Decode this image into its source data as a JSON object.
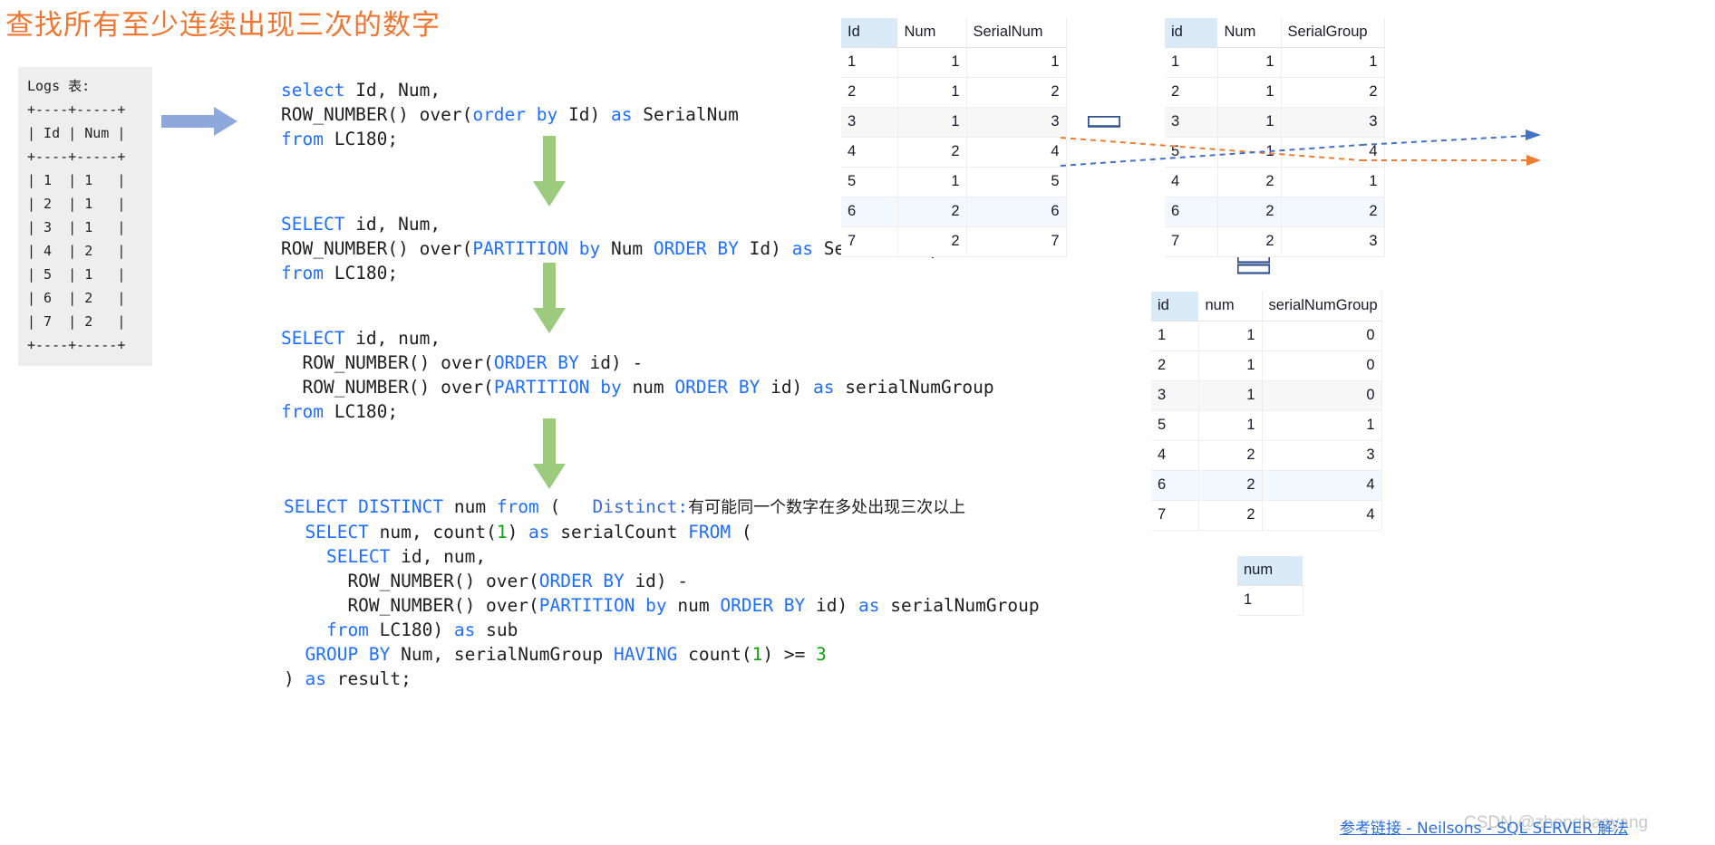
{
  "title": "查找所有至少连续出现三次的数字",
  "logs_table": {
    "caption": "Logs 表:",
    "ascii": "Logs 表:\n+----+-----+\n| Id | Num |\n+----+-----+\n| 1  | 1   |\n| 2  | 1   |\n| 3  | 1   |\n| 4  | 2   |\n| 5  | 1   |\n| 6  | 2   |\n| 7  | 2   |\n+----+-----+"
  },
  "sql_blocks": {
    "block1": {
      "lines": [
        [
          {
            "t": "select ",
            "c": "kw"
          },
          {
            "t": "Id, Num,",
            "c": ""
          }
        ],
        [
          {
            "t": "ROW_NUMBER() over(",
            "c": ""
          },
          {
            "t": "order by ",
            "c": "kw"
          },
          {
            "t": "Id) ",
            "c": ""
          },
          {
            "t": "as ",
            "c": "kw"
          },
          {
            "t": "SerialNum",
            "c": ""
          }
        ],
        [
          {
            "t": "from ",
            "c": "kw"
          },
          {
            "t": "LC180;",
            "c": ""
          }
        ]
      ]
    },
    "block2": {
      "lines": [
        [
          {
            "t": "SELECT ",
            "c": "kw"
          },
          {
            "t": "id, Num,",
            "c": ""
          }
        ],
        [
          {
            "t": "ROW_NUMBER() over(",
            "c": ""
          },
          {
            "t": "PARTITION by ",
            "c": "kw"
          },
          {
            "t": "Num ",
            "c": ""
          },
          {
            "t": "ORDER BY ",
            "c": "kw"
          },
          {
            "t": "Id) ",
            "c": ""
          },
          {
            "t": "as ",
            "c": "kw"
          },
          {
            "t": "SerialGroup",
            "c": ""
          }
        ],
        [
          {
            "t": "from ",
            "c": "kw"
          },
          {
            "t": "LC180;",
            "c": ""
          }
        ]
      ]
    },
    "block3": {
      "lines": [
        [
          {
            "t": "SELECT ",
            "c": "kw"
          },
          {
            "t": "id, num,",
            "c": ""
          }
        ],
        [
          {
            "t": "  ROW_NUMBER() over(",
            "c": ""
          },
          {
            "t": "ORDER BY ",
            "c": "kw"
          },
          {
            "t": "id) -",
            "c": ""
          }
        ],
        [
          {
            "t": "  ROW_NUMBER() over(",
            "c": ""
          },
          {
            "t": "PARTITION by ",
            "c": "kw"
          },
          {
            "t": "num ",
            "c": ""
          },
          {
            "t": "ORDER BY ",
            "c": "kw"
          },
          {
            "t": "id) ",
            "c": ""
          },
          {
            "t": "as ",
            "c": "kw"
          },
          {
            "t": "serialNumGroup",
            "c": ""
          }
        ],
        [
          {
            "t": "from ",
            "c": "kw"
          },
          {
            "t": "LC180;",
            "c": ""
          }
        ]
      ]
    },
    "block4": {
      "lines": [
        [
          {
            "t": "SELECT DISTINCT ",
            "c": "kw"
          },
          {
            "t": "num ",
            "c": ""
          },
          {
            "t": "from ",
            "c": "kw"
          },
          {
            "t": "(   ",
            "c": ""
          },
          {
            "t": "Distinct:",
            "c": "cmt"
          },
          {
            "t": "有可能同一个数字在多处出现三次以上",
            "c": "cmt-cn"
          }
        ],
        [
          {
            "t": "  SELECT ",
            "c": "kw"
          },
          {
            "t": "num, count(",
            "c": ""
          },
          {
            "t": "1",
            "c": "num"
          },
          {
            "t": ") ",
            "c": ""
          },
          {
            "t": "as ",
            "c": "kw"
          },
          {
            "t": "serialCount ",
            "c": ""
          },
          {
            "t": "FROM ",
            "c": "kw"
          },
          {
            "t": "(",
            "c": ""
          }
        ],
        [
          {
            "t": "    SELECT ",
            "c": "kw"
          },
          {
            "t": "id, num,",
            "c": ""
          }
        ],
        [
          {
            "t": "      ROW_NUMBER() over(",
            "c": ""
          },
          {
            "t": "ORDER BY ",
            "c": "kw"
          },
          {
            "t": "id) -",
            "c": ""
          }
        ],
        [
          {
            "t": "      ROW_NUMBER() over(",
            "c": ""
          },
          {
            "t": "PARTITION by ",
            "c": "kw"
          },
          {
            "t": "num ",
            "c": ""
          },
          {
            "t": "ORDER BY ",
            "c": "kw"
          },
          {
            "t": "id) ",
            "c": ""
          },
          {
            "t": "as ",
            "c": "kw"
          },
          {
            "t": "serialNumGroup",
            "c": ""
          }
        ],
        [
          {
            "t": "    from ",
            "c": "kw"
          },
          {
            "t": "LC180) ",
            "c": ""
          },
          {
            "t": "as ",
            "c": "kw"
          },
          {
            "t": "sub",
            "c": ""
          }
        ],
        [
          {
            "t": "  GROUP BY ",
            "c": "kw"
          },
          {
            "t": "Num, serialNumGroup ",
            "c": ""
          },
          {
            "t": "HAVING ",
            "c": "kw"
          },
          {
            "t": "count(",
            "c": ""
          },
          {
            "t": "1",
            "c": "num"
          },
          {
            "t": ") >= ",
            "c": ""
          },
          {
            "t": "3",
            "c": "num"
          }
        ],
        [
          {
            "t": ") ",
            "c": ""
          },
          {
            "t": "as ",
            "c": "kw"
          },
          {
            "t": "result;",
            "c": ""
          }
        ]
      ]
    }
  },
  "grids": {
    "serialnum": {
      "headers": [
        "Id",
        "Num",
        "SerialNum"
      ],
      "rows": [
        [
          "1",
          "1",
          "1"
        ],
        [
          "2",
          "1",
          "2"
        ],
        [
          "3",
          "1",
          "3"
        ],
        [
          "4",
          "2",
          "4"
        ],
        [
          "5",
          "1",
          "5"
        ],
        [
          "6",
          "2",
          "6"
        ],
        [
          "7",
          "2",
          "7"
        ]
      ]
    },
    "serialgroup": {
      "headers": [
        "id",
        "Num",
        "SerialGroup"
      ],
      "rows": [
        [
          "1",
          "1",
          "1"
        ],
        [
          "2",
          "1",
          "2"
        ],
        [
          "3",
          "1",
          "3"
        ],
        [
          "5",
          "1",
          "4"
        ],
        [
          "4",
          "2",
          "1"
        ],
        [
          "6",
          "2",
          "2"
        ],
        [
          "7",
          "2",
          "3"
        ]
      ]
    },
    "serialnumgroup": {
      "headers": [
        "id",
        "num",
        "serialNumGroup"
      ],
      "rows": [
        [
          "1",
          "1",
          "0"
        ],
        [
          "2",
          "1",
          "0"
        ],
        [
          "3",
          "1",
          "0"
        ],
        [
          "5",
          "1",
          "1"
        ],
        [
          "4",
          "2",
          "3"
        ],
        [
          "6",
          "2",
          "4"
        ],
        [
          "7",
          "2",
          "4"
        ]
      ]
    },
    "result": {
      "headers": [
        "num"
      ],
      "rows": [
        [
          "1"
        ]
      ]
    }
  },
  "footer": {
    "reference_link": "参考链接 - Neilsons - SQL SERVER 解法",
    "watermark": "CSDN @zhenghaoyang"
  },
  "colors": {
    "title": "#ee7733",
    "keyword": "#1f6fff",
    "number": "#12a012",
    "comment": "#3b6fd4",
    "arrow_green": "#9ccb7d",
    "arrow_blue": "#8fa8dc",
    "connector_orange": "#ed7d31",
    "connector_blue": "#4472c4",
    "grid_header": "#dbeaf7",
    "link": "#2a6fd8"
  }
}
